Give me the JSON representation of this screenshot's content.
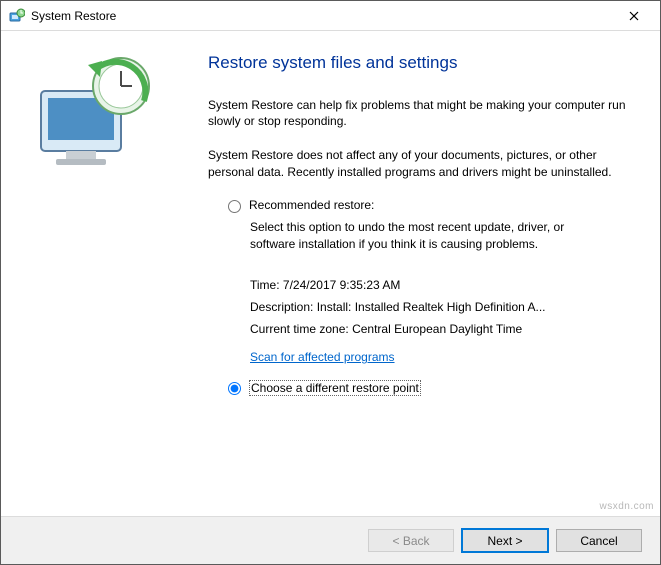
{
  "window": {
    "title": "System Restore"
  },
  "heading": "Restore system files and settings",
  "paragraph1": "System Restore can help fix problems that might be making your computer run slowly or stop responding.",
  "paragraph2": "System Restore does not affect any of your documents, pictures, or other personal data. Recently installed programs and drivers might be uninstalled.",
  "option_recommended": {
    "label": "Recommended restore:",
    "description": "Select this option to undo the most recent update, driver, or software installation if you think it is causing problems.",
    "details": {
      "time_label": "Time:",
      "time_value": "7/24/2017 9:35:23 AM",
      "description_label": "Description:",
      "description_value": "Install: Installed Realtek High Definition A...",
      "timezone_label": "Current time zone:",
      "timezone_value": "Central European Daylight Time"
    },
    "scan_link": "Scan for affected programs"
  },
  "option_choose": {
    "label": "Choose a different restore point"
  },
  "buttons": {
    "back": "< Back",
    "next": "Next >",
    "cancel": "Cancel"
  },
  "watermark": "wsxdn.com"
}
